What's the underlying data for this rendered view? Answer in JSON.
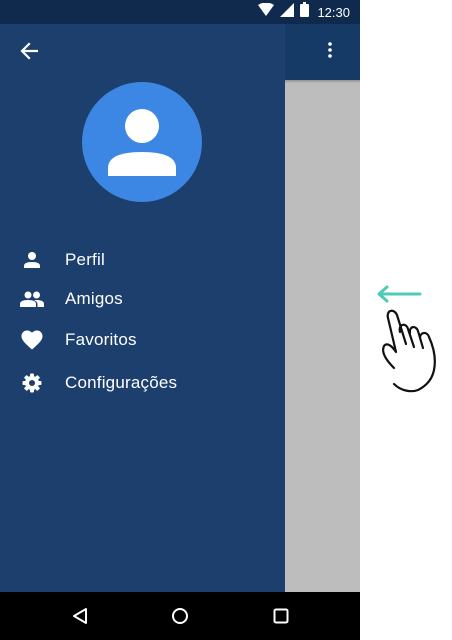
{
  "status_bar": {
    "time": "12:30",
    "icons": [
      "wifi-icon",
      "cellular-signal-icon",
      "battery-icon"
    ]
  },
  "app_bar": {
    "actions": [
      "more-vert-icon"
    ]
  },
  "drawer": {
    "back_icon": "arrow-back-icon",
    "avatar_icon": "person-icon",
    "items": [
      {
        "label": "Perfil",
        "icon": "person-icon"
      },
      {
        "label": "Amigos",
        "icon": "people-icon"
      },
      {
        "label": "Favoritos",
        "icon": "heart-icon"
      },
      {
        "label": "Configurações",
        "icon": "gear-icon"
      }
    ]
  },
  "nav_bar": {
    "buttons": [
      "back-triangle-icon",
      "home-circle-icon",
      "recents-square-icon"
    ]
  },
  "gesture_hint": {
    "direction": "left",
    "icons": [
      "swipe-left-arrow-icon",
      "hand-pointer-icon"
    ]
  },
  "colors": {
    "status_bar": "#0f2a4d",
    "app_bar": "#163a66",
    "drawer": "#1c3f6e",
    "avatar": "#3b87e3",
    "scrim_area": "#bdbdbd",
    "gesture_arrow": "#4fc9b8"
  }
}
